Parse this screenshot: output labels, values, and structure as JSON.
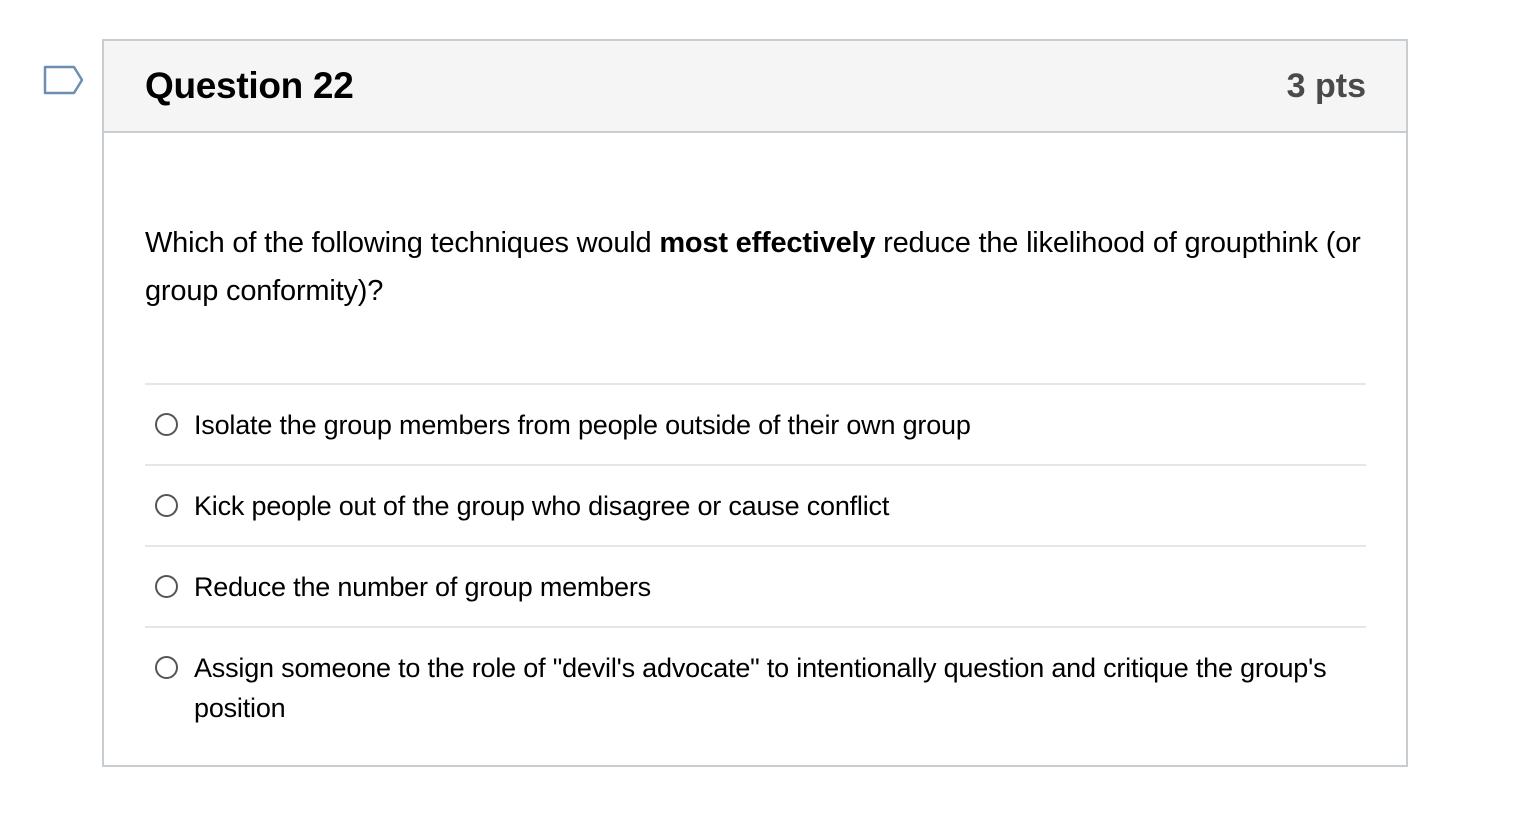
{
  "question": {
    "title": "Question 22",
    "points": "3 pts",
    "text_before": "Which of the following techniques would ",
    "text_bold": "most effectively",
    "text_after": " reduce the likelihood of groupthink (or group conformity)?"
  },
  "answers": [
    {
      "label": "Isolate the group members from people outside of their own group",
      "selected": false
    },
    {
      "label": "Kick people out of the group who disagree or cause conflict",
      "selected": false
    },
    {
      "label": "Reduce the number of group members",
      "selected": false
    },
    {
      "label": "Assign someone to the role of \"devil's advocate\" to intentionally question and critique the group's position",
      "selected": false
    }
  ],
  "flag": {
    "icon": "flag-bookmark-icon",
    "color": "#6a8fb3"
  }
}
